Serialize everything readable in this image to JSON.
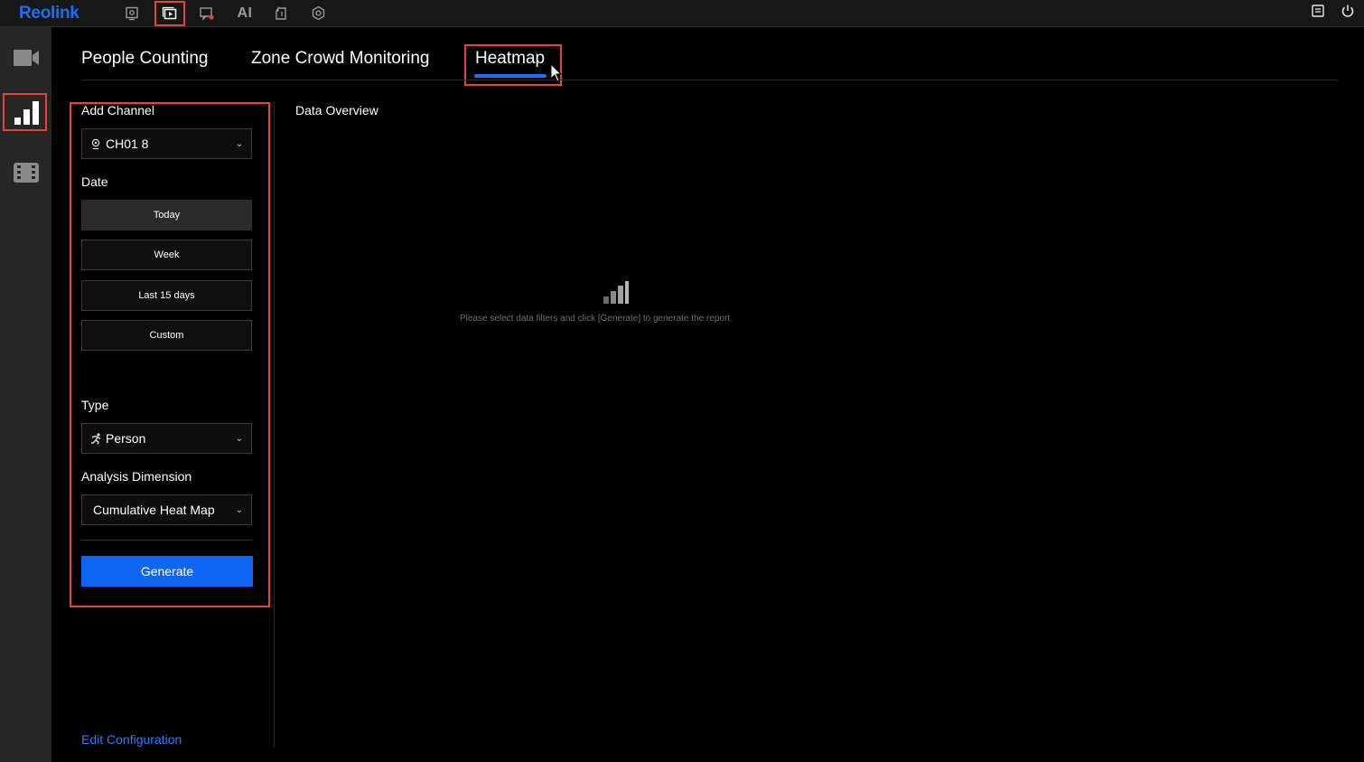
{
  "app": {
    "logo": "Reolink"
  },
  "topnav": {
    "ai_label": "AI"
  },
  "tabs": [
    {
      "label": "People Counting"
    },
    {
      "label": "Zone Crowd Monitoring"
    },
    {
      "label": "Heatmap",
      "active": true
    }
  ],
  "filters": {
    "channel_label": "Add Channel",
    "channel_value": "CH01 8",
    "date_label": "Date",
    "date_options": [
      "Today",
      "Week",
      "Last 15 days",
      "Custom"
    ],
    "date_selected": "Today",
    "type_label": "Type",
    "type_value": "Person",
    "dimension_label": "Analysis Dimension",
    "dimension_value": "Cumulative Heat Map",
    "generate_label": "Generate",
    "edit_config_label": "Edit Configuration"
  },
  "main": {
    "title": "Data Overview",
    "empty_message": "Please select data filters and click [Generate] to generate the report."
  },
  "colors": {
    "accent": "#0f66f5",
    "highlight": "#e8423f",
    "background": "#000000"
  }
}
